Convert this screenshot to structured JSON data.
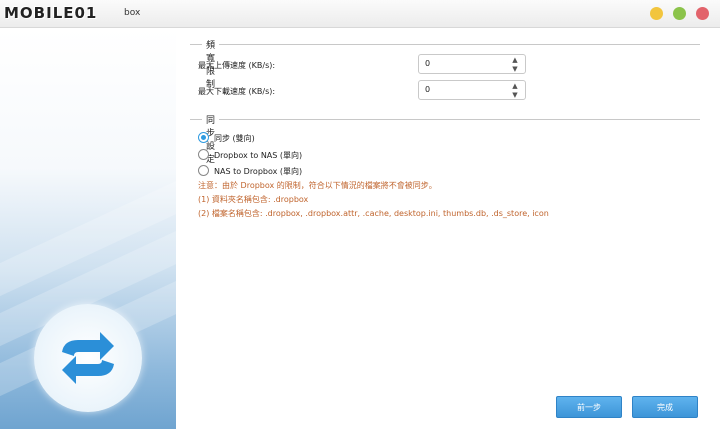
{
  "window": {
    "logo_text": "MOBILE01",
    "title_suffix": "box"
  },
  "bandwidth": {
    "section_title": "頻寬限制",
    "upload_label": "最大上傳速度 (KB/s):",
    "upload_value": "0",
    "download_label": "最大下載速度 (KB/s):",
    "download_value": "0"
  },
  "sync": {
    "section_title": "同步設定",
    "options": [
      {
        "label": "同步 (雙向)",
        "checked": true
      },
      {
        "label": "Dropbox to NAS (單向)",
        "checked": false
      },
      {
        "label": "NAS to Dropbox (單向)",
        "checked": false
      }
    ],
    "notes": [
      "注意：由於 Dropbox 的限制，符合以下情況的檔案將不會被同步。",
      "(1) 資料夾名稱包含: .dropbox",
      "(2) 檔案名稱包含: .dropbox, .dropbox.attr, .cache, desktop.ini, thumbs.db, .ds_store, icon"
    ]
  },
  "buttons": {
    "prev": "前一步",
    "finish": "完成"
  },
  "colors": {
    "accent": "#2f9be0",
    "note": "#c0642d",
    "button": "#4aa3e3"
  }
}
